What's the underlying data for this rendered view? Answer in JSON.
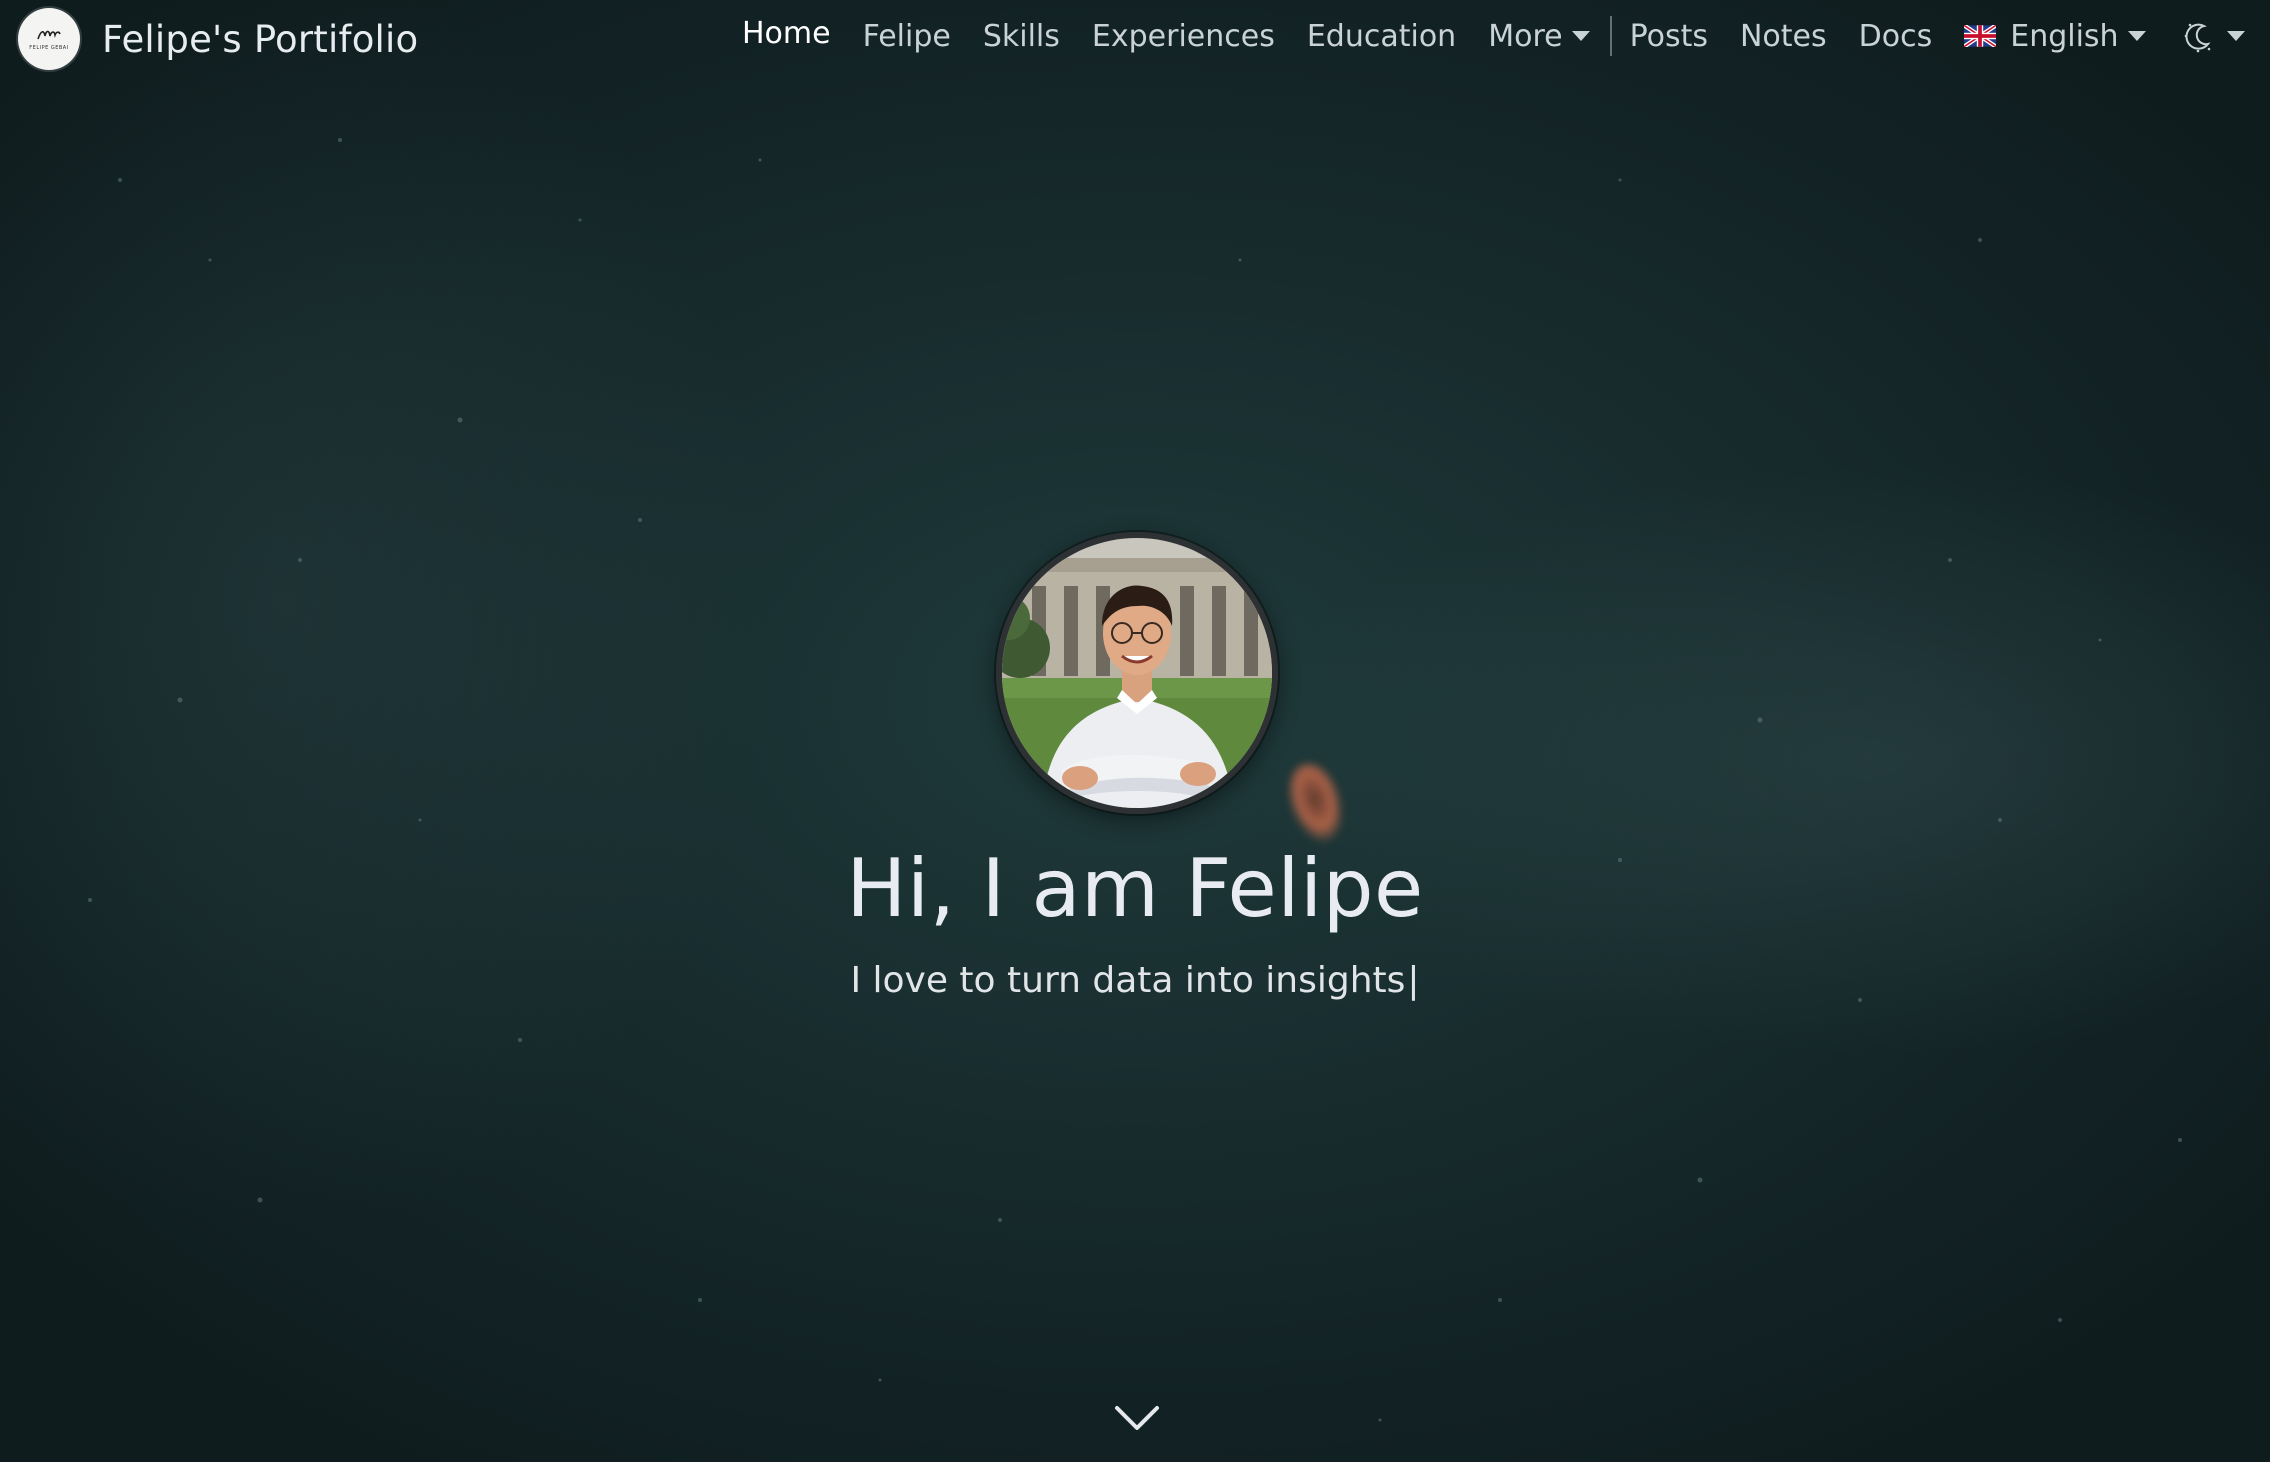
{
  "brand": {
    "title": "Felipe's Portifolio",
    "logo_icon": "signature-logo-icon",
    "logo_caption": "FELIPE GEBAI"
  },
  "nav": {
    "items": [
      {
        "label": "Home",
        "active": true
      },
      {
        "label": "Felipe",
        "active": false
      },
      {
        "label": "Skills",
        "active": false
      },
      {
        "label": "Experiences",
        "active": false
      },
      {
        "label": "Education",
        "active": false
      }
    ],
    "more_label": "More",
    "items_right": [
      {
        "label": "Posts"
      },
      {
        "label": "Notes"
      },
      {
        "label": "Docs"
      }
    ],
    "language": {
      "label": "English",
      "flag_icon": "uk-flag-icon"
    },
    "theme_icon": "moon-sun-icon"
  },
  "hero": {
    "title": "Hi, I am Felipe",
    "subtitle": "I love to turn data into insights",
    "cursor": "|",
    "scroll_icon": "chevron-down-icon"
  },
  "colors": {
    "background": "#142426",
    "text": "#e8ebf1",
    "nav_text": "#c9d3d6",
    "nav_active": "#ffffff"
  }
}
